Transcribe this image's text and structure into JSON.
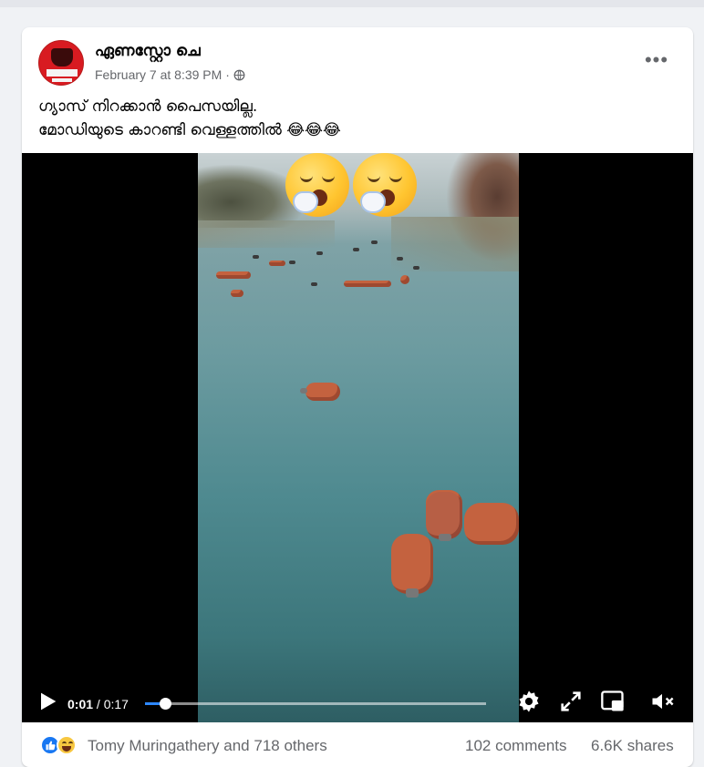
{
  "post": {
    "author": "ഏണസ്റ്റോ ചെ",
    "timestamp": "February 7 at 8:39 PM",
    "separator": "·",
    "privacy_icon": "globe-icon",
    "more_icon": "more-horizontal-icon",
    "more_label": "•••",
    "caption_line1": "ഗ്യാസ് നിറക്കാൻ പൈസയില്ല.",
    "caption_line2": "മോഡിയുടെ കാറണ്ടി വെള്ളത്തിൽ",
    "caption_emojis": [
      "😂",
      "😂",
      "😂"
    ]
  },
  "video": {
    "current_time": "0:01",
    "time_separator": " / ",
    "duration": "0:17",
    "progress": 0.06,
    "overlay_emojis": [
      "yawning-face-emoji",
      "yawning-face-emoji"
    ],
    "controls": [
      "play-icon",
      "settings-icon",
      "fullscreen-icon",
      "picture-in-picture-icon",
      "muted-speaker-icon"
    ]
  },
  "footer": {
    "reaction_icons": [
      "like-icon",
      "haha-icon"
    ],
    "reactors": "Tomy Muringathery and 718 others",
    "comments": "102 comments",
    "shares": "6.6K shares"
  },
  "colors": {
    "accent": "#1877f2",
    "progress": "#2d88ff",
    "background": "#f0f2f5",
    "secondary_text": "#65676b"
  }
}
